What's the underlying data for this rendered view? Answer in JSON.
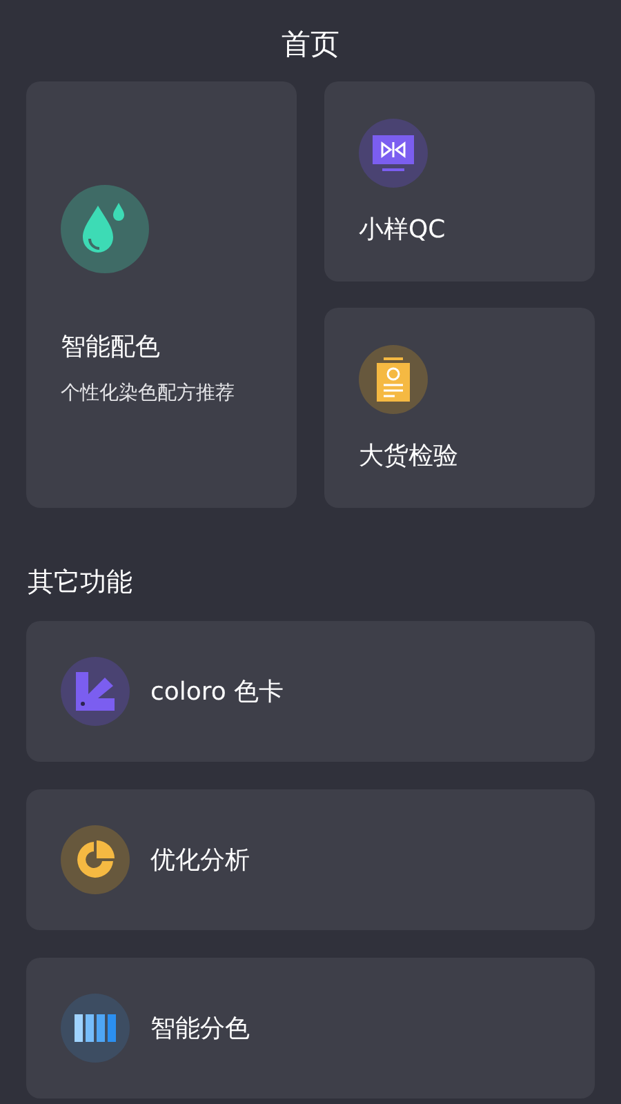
{
  "header": {
    "title": "首页"
  },
  "main_features": [
    {
      "kind": "drop",
      "title": "智能配色",
      "subtitle": "个性化染色配方推荐"
    },
    {
      "kind": "monitor",
      "title": "小样QC"
    },
    {
      "kind": "clipboard",
      "title": "大货检验"
    }
  ],
  "other_section": {
    "title": "其它功能",
    "items": [
      {
        "kind": "swatch",
        "label": "coloro 色卡"
      },
      {
        "kind": "pie",
        "label": "优化分析"
      },
      {
        "kind": "bars",
        "label": "智能分色"
      }
    ]
  }
}
